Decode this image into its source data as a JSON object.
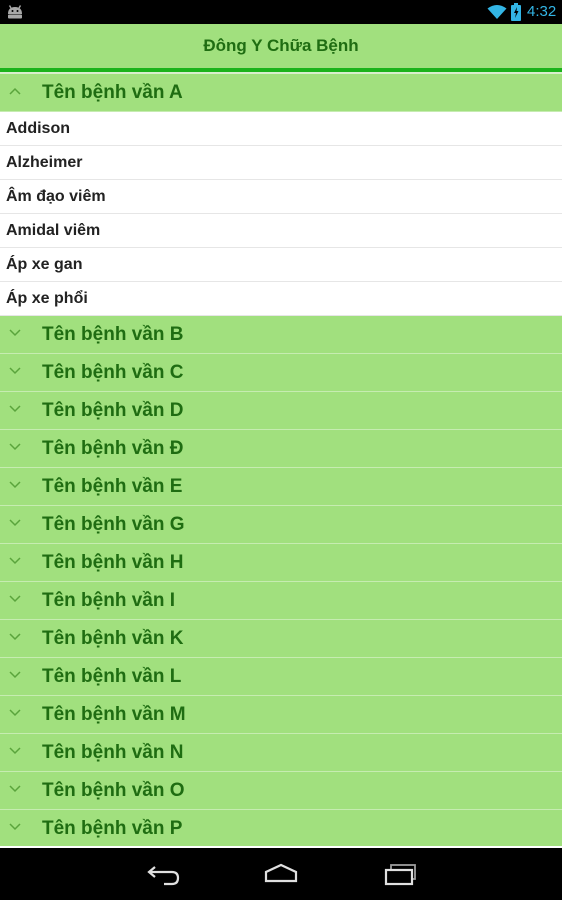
{
  "status_bar": {
    "time": "4:32",
    "accent_color": "#33b5e5",
    "icons": [
      "android-icon",
      "wifi-icon",
      "battery-icon"
    ]
  },
  "action_bar": {
    "title": "Đông Y Chữa Bệnh",
    "background_color": "#a1e07e",
    "text_color": "#1f6d12",
    "divider_color": "#1bb31b"
  },
  "groups": [
    {
      "label": "Tên bệnh vần A",
      "expanded": true,
      "children": [
        "Addison",
        "Alzheimer",
        "Âm đạo viêm",
        "Amidal viêm",
        "Áp xe gan",
        "Áp xe phổi"
      ]
    },
    {
      "label": "Tên bệnh vần B",
      "expanded": false
    },
    {
      "label": "Tên bệnh vần C",
      "expanded": false
    },
    {
      "label": "Tên bệnh vần D",
      "expanded": false
    },
    {
      "label": "Tên bệnh vần Đ",
      "expanded": false
    },
    {
      "label": "Tên bệnh vần E",
      "expanded": false
    },
    {
      "label": "Tên bệnh vần G",
      "expanded": false
    },
    {
      "label": "Tên bệnh vần H",
      "expanded": false
    },
    {
      "label": "Tên bệnh vần I",
      "expanded": false
    },
    {
      "label": "Tên bệnh vần K",
      "expanded": false
    },
    {
      "label": "Tên bệnh vần L",
      "expanded": false
    },
    {
      "label": "Tên bệnh vần M",
      "expanded": false
    },
    {
      "label": "Tên bệnh vần N",
      "expanded": false
    },
    {
      "label": "Tên bệnh vần O",
      "expanded": false
    },
    {
      "label": "Tên bệnh vần P",
      "expanded": false
    }
  ],
  "nav_bar": {
    "icons": [
      "back-icon",
      "home-icon",
      "recents-icon"
    ]
  }
}
